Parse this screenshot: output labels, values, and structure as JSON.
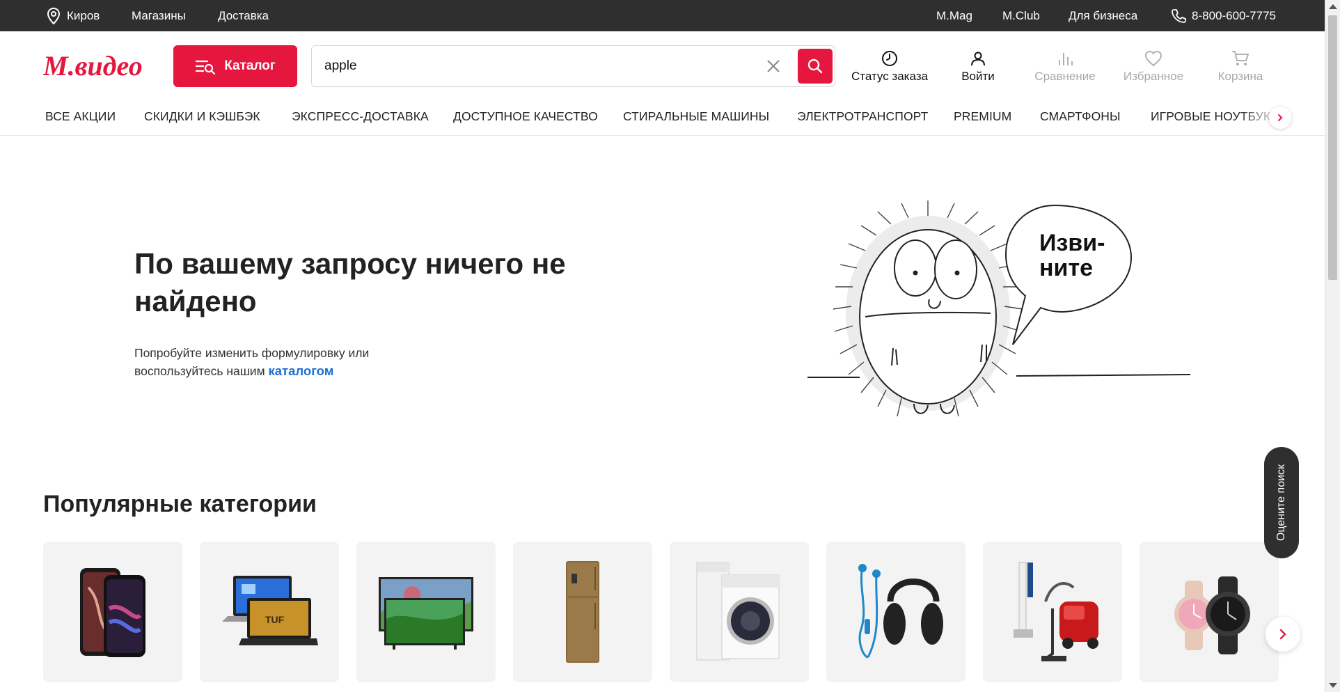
{
  "topbar": {
    "city": "Киров",
    "stores": "Магазины",
    "delivery": "Доставка",
    "mmag": "M.Mag",
    "mclub": "M.Club",
    "business": "Для бизнеса",
    "phone": "8-800-600-7775"
  },
  "header": {
    "logo_text": "М.видео",
    "catalog_label": "Каталог",
    "search_value": "apple",
    "actions": {
      "order_status": "Статус заказа",
      "login": "Войти",
      "compare": "Сравнение",
      "favorites": "Избранное",
      "cart": "Корзина"
    }
  },
  "catnav": {
    "items": [
      "ВСЕ АКЦИИ",
      "СКИДКИ И КЭШБЭК",
      "ЭКСПРЕСС-ДОСТАВКА",
      "ДОСТУПНОЕ КАЧЕСТВО",
      "СТИРАЛЬНЫЕ МАШИНЫ",
      "ЭЛЕКТРОТРАНСПОРТ",
      "PREMIUM",
      "СМАРТФОНЫ",
      "ИГРОВЫЕ НОУТБУКИ"
    ]
  },
  "empty": {
    "title": "По вашему запросу ничего не найдено",
    "text_line1": "Попробуйте изменить формулировку или",
    "text_line2": "воспользуйтесь нашим",
    "catalog_link": "каталогом",
    "bubble_line1": "Изви-",
    "bubble_line2": "ните"
  },
  "popular": {
    "title": "Популярные категории",
    "items": [
      {
        "icon": "smartphones-image"
      },
      {
        "icon": "laptops-image"
      },
      {
        "icon": "tv-image"
      },
      {
        "icon": "refrigerator-image"
      },
      {
        "icon": "washing-machine-image"
      },
      {
        "icon": "headphones-image"
      },
      {
        "icon": "vacuum-cleaner-image"
      },
      {
        "icon": "smartwatch-image"
      }
    ]
  },
  "rate_search": "Оцените поиск",
  "colors": {
    "brand_red": "#e5173f",
    "topbar_bg": "#2f2f2f",
    "link_blue": "#1e6fd9"
  }
}
